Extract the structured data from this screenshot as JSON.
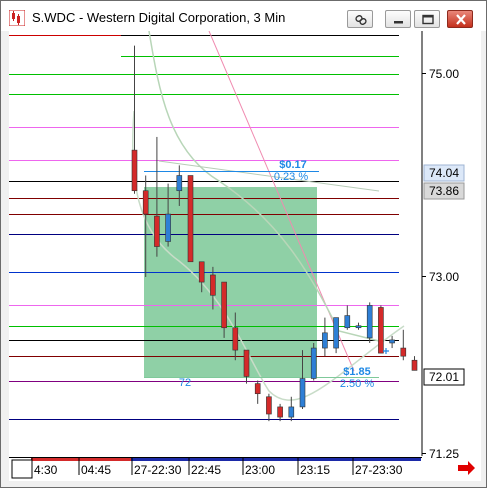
{
  "window": {
    "title": "S.WDC - Western Digital Corporation, 3 Min",
    "buttons": [
      "link-icon",
      "minimize-icon",
      "maximize-icon",
      "close-icon"
    ],
    "colors": {
      "close_button": "#c8402a"
    }
  },
  "chart_data": {
    "type": "candlestick",
    "title": "S.WDC - Western Digital Corporation, 3 Min",
    "price_ticks": [
      "75.00",
      "73.00",
      "72.01",
      "71.25"
    ],
    "price_markers": [
      {
        "label": "74.04",
        "kind": "highlight"
      },
      {
        "label": "73.86",
        "kind": "gray"
      },
      {
        "label": "72.01",
        "kind": "box"
      }
    ],
    "time_labels": [
      "4:30",
      "04:45",
      "27-22:30",
      "22:45",
      "23:00",
      "23:15",
      "27-23:30"
    ],
    "ylim": [
      71.25,
      75.3
    ],
    "horizontal_lines": [
      {
        "price": 75.38,
        "color": "#000000"
      },
      {
        "price": 75.18,
        "color": "#00c000"
      },
      {
        "price": 75.0,
        "color": "#00c000"
      },
      {
        "price": 74.8,
        "color": "#00c000"
      },
      {
        "price": 74.48,
        "color": "#ee66ee"
      },
      {
        "price": 74.15,
        "color": "#ee66ee"
      },
      {
        "price": 73.95,
        "color": "#000000"
      },
      {
        "price": 73.78,
        "color": "#800000"
      },
      {
        "price": 73.62,
        "color": "#800000"
      },
      {
        "price": 73.42,
        "color": "#000080"
      },
      {
        "price": 73.05,
        "color": "#0033cc"
      },
      {
        "price": 72.72,
        "color": "#ee66ee"
      },
      {
        "price": 72.52,
        "color": "#00c000"
      },
      {
        "price": 72.38,
        "color": "#000000"
      },
      {
        "price": 72.22,
        "color": "#800000"
      },
      {
        "price": 71.98,
        "color": "#800080"
      },
      {
        "price": 71.6,
        "color": "#000080"
      }
    ],
    "candles": [
      {
        "open": 74.25,
        "high": 75.28,
        "low": 73.82,
        "close": 73.85
      },
      {
        "open": 73.85,
        "high": 74.0,
        "low": 73.0,
        "close": 73.62
      },
      {
        "open": 73.6,
        "high": 74.38,
        "low": 73.2,
        "close": 73.3
      },
      {
        "open": 73.35,
        "high": 73.92,
        "low": 73.3,
        "close": 73.62
      },
      {
        "open": 73.85,
        "high": 74.1,
        "low": 73.7,
        "close": 74.0
      },
      {
        "open": 74.0,
        "high": 74.0,
        "low": 73.15,
        "close": 73.15
      },
      {
        "open": 73.15,
        "high": 73.12,
        "low": 72.85,
        "close": 72.95
      },
      {
        "open": 73.02,
        "high": 73.1,
        "low": 72.68,
        "close": 72.82
      },
      {
        "open": 72.95,
        "high": 72.95,
        "low": 72.4,
        "close": 72.5
      },
      {
        "open": 72.5,
        "high": 72.65,
        "low": 72.18,
        "close": 72.28
      },
      {
        "open": 72.28,
        "high": 72.28,
        "low": 71.95,
        "close": 72.02
      },
      {
        "open": 71.95,
        "high": 71.98,
        "low": 71.75,
        "close": 71.85
      },
      {
        "open": 71.82,
        "high": 71.85,
        "low": 71.58,
        "close": 71.65
      },
      {
        "open": 71.72,
        "high": 71.75,
        "low": 71.58,
        "close": 71.62
      },
      {
        "open": 71.62,
        "high": 71.82,
        "low": 71.58,
        "close": 71.72
      },
      {
        "open": 71.72,
        "high": 72.28,
        "low": 71.7,
        "close": 72.0
      },
      {
        "open": 72.0,
        "high": 72.35,
        "low": 71.98,
        "close": 72.3
      },
      {
        "open": 72.3,
        "high": 72.6,
        "low": 72.22,
        "close": 72.45
      },
      {
        "open": 72.3,
        "high": 72.6,
        "low": 72.25,
        "close": 72.6
      },
      {
        "open": 72.5,
        "high": 72.72,
        "low": 72.48,
        "close": 72.62
      },
      {
        "open": 72.5,
        "high": 72.55,
        "low": 72.48,
        "close": 72.52
      },
      {
        "open": 72.4,
        "high": 72.75,
        "low": 72.35,
        "close": 72.72
      },
      {
        "open": 72.7,
        "high": 72.72,
        "low": 72.25,
        "close": 72.25
      },
      {
        "open": 72.35,
        "high": 72.42,
        "low": 72.3,
        "close": 72.38
      },
      {
        "open": 72.3,
        "high": 72.48,
        "low": 72.18,
        "close": 72.22
      },
      {
        "open": 72.18,
        "high": 72.22,
        "low": 72.08,
        "close": 72.08
      }
    ],
    "annotations": [
      {
        "text": "$0.17",
        "color": "#1e88e5",
        "bold": true
      },
      {
        "text": "0.23 %",
        "color": "#1e88e5"
      },
      {
        "text": "$1.85",
        "color": "#1e88e5",
        "bold": true
      },
      {
        "text": "2.50 %",
        "color": "#1e88e5"
      },
      {
        "text": "72",
        "color": "#1e88e5"
      }
    ],
    "colors": {
      "up": "#2e7fd6",
      "down": "#d42a2a",
      "doji": "#8b5a2b",
      "measure_box": "#7fc99a",
      "arrow": "#e00000"
    }
  }
}
